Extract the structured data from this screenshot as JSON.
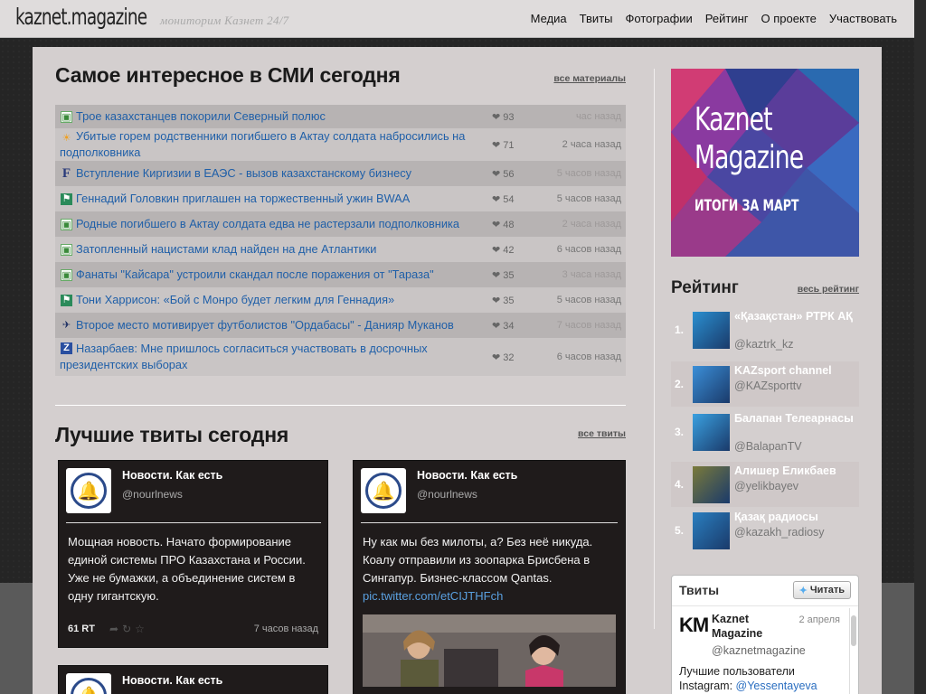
{
  "header": {
    "logo": "kaznet.magazine",
    "tagline": "мониторим Казнет 24/7",
    "nav": [
      "Медиа",
      "Твиты",
      "Фотографии",
      "Рейтинг",
      "О проекте",
      "Участвовать"
    ]
  },
  "news": {
    "heading": "Самое интересное в СМИ сегодня",
    "see_all": "все материалы",
    "items": [
      {
        "icon": "tengrinews-icon",
        "title": "Трое казахстанцев покорили Северный полюс",
        "likes": "93",
        "time": "час назад"
      },
      {
        "icon": "sun-icon",
        "title": "Убитые горем родственники погибшего в Актау солдата набросились на подполковника",
        "likes": "71",
        "time": "2 часа назад"
      },
      {
        "icon": "forbes-icon",
        "title": "Вступление Киргизии в ЕАЭС - вызов казахстанскому бизнесу",
        "likes": "56",
        "time": "5 часов назад"
      },
      {
        "icon": "sports-icon",
        "title": "Геннадий Головкин приглашен на торжественный ужин BWAA",
        "likes": "54",
        "time": "5 часов назад"
      },
      {
        "icon": "tengrinews-icon",
        "title": "Родные погибшего в Актау солдата едва не растерзали подполковника",
        "likes": "48",
        "time": "2 часа назад"
      },
      {
        "icon": "tengrinews-icon",
        "title": "Затопленный нацистами клад найден на дне Атлантики",
        "likes": "42",
        "time": "6 часов назад"
      },
      {
        "icon": "tengrinews-icon",
        "title": "Фанаты \"Кайсара\" устроили скандал после поражения от \"Тараза\"",
        "likes": "35",
        "time": "3 часа назад"
      },
      {
        "icon": "sports-icon",
        "title": "Тони Харрисон: «Бой с Монро будет легким для Геннадия»",
        "likes": "35",
        "time": "5 часов назад"
      },
      {
        "icon": "bird-icon",
        "title": "Второе место мотивирует футболистов \"Ордабасы\" - Данияр Муканов",
        "likes": "34",
        "time": "7 часов назад"
      },
      {
        "icon": "zakon-icon",
        "title": "Назарбаев: Мне пришлось согласиться участвовать в досрочных президентских выборах",
        "likes": "32",
        "time": "6 часов назад"
      }
    ]
  },
  "tweets": {
    "heading": "Лучшие твиты сегодня",
    "see_all": "все твиты",
    "cards": [
      {
        "name": "Новости. Как есть",
        "handle": "@nourlnews",
        "text": "Мощная новость. Начато формирование единой системы ПРО Казахстана и России. Уже не бумажки, а объединение систем в одну гигантскую.",
        "rt": "61 RT",
        "time": "7 часов назад"
      },
      {
        "name": "Новости. Как есть",
        "handle": "@nourlnews",
        "text": "Ну как мы без милоты, а? Без неё никуда. Коалу отправили из зоопарка Брисбена в Сингапур. Бизнес-классом Qantas.",
        "link": "pic.twitter.com/etCIJTHFch"
      },
      {
        "name": "Новости. Как есть"
      }
    ]
  },
  "sidebar": {
    "banner": {
      "line1": "Kaznet",
      "line2": "Magazine",
      "line3": "ИТОГИ ЗА МАРТ"
    },
    "rating": {
      "heading": "Рейтинг",
      "see_all": "весь рейтинг",
      "items": [
        {
          "num": "1.",
          "name": "«Қазақстан» РТРК АҚ",
          "handle": "@kaztrk_kz",
          "color": "#2a8fd0"
        },
        {
          "num": "2.",
          "name": "KAZsport channel",
          "handle": "@KAZsporttv",
          "color": "#3b8fd8"
        },
        {
          "num": "3.",
          "name": "Балапан Телеарнасы",
          "handle": "@BalapanTV",
          "color": "#3aa0e0"
        },
        {
          "num": "4.",
          "name": "Алишер Еликбаев",
          "handle": "@yelikbayev",
          "color": "#7a7a3a"
        },
        {
          "num": "5.",
          "name": "Қазақ радиосы",
          "handle": "@kazakh_radiosy",
          "color": "#2a7fc0"
        }
      ]
    },
    "twitter_widget": {
      "heading": "Твиты",
      "follow": "Читать",
      "logo": "KM",
      "name": "Kaznet Magazine",
      "date": "2 апреля",
      "handle": "@kaznetmagazine",
      "text": "Лучшие пользователи Instagram: ",
      "mention": "@Yessentayeva"
    }
  }
}
